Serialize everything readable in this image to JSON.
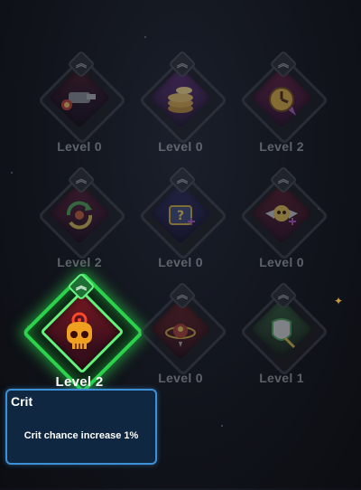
{
  "skills": [
    {
      "level": "Level 0",
      "icon": "ship-cannon-icon"
    },
    {
      "level": "Level 0",
      "icon": "coin-stack-icon"
    },
    {
      "level": "Level 2",
      "icon": "cooldown-clock-icon"
    },
    {
      "level": "Level 2",
      "icon": "refresh-cycle-icon"
    },
    {
      "level": "Level 0",
      "icon": "mystery-box-icon"
    },
    {
      "level": "Level 0",
      "icon": "winged-skull-icon"
    },
    {
      "level": "Level 2",
      "icon": "crit-skull-icon"
    },
    {
      "level": "Level 0",
      "icon": "orbit-bomb-icon"
    },
    {
      "level": "Level 1",
      "icon": "shield-tooth-icon"
    }
  ],
  "tooltip": {
    "title": "Crit",
    "description": "Crit chance increase 1%"
  },
  "colors": {
    "selected_glow": "#2bd24a",
    "tooltip_border": "#3d8fd6",
    "tooltip_bg": "#0f2740"
  }
}
